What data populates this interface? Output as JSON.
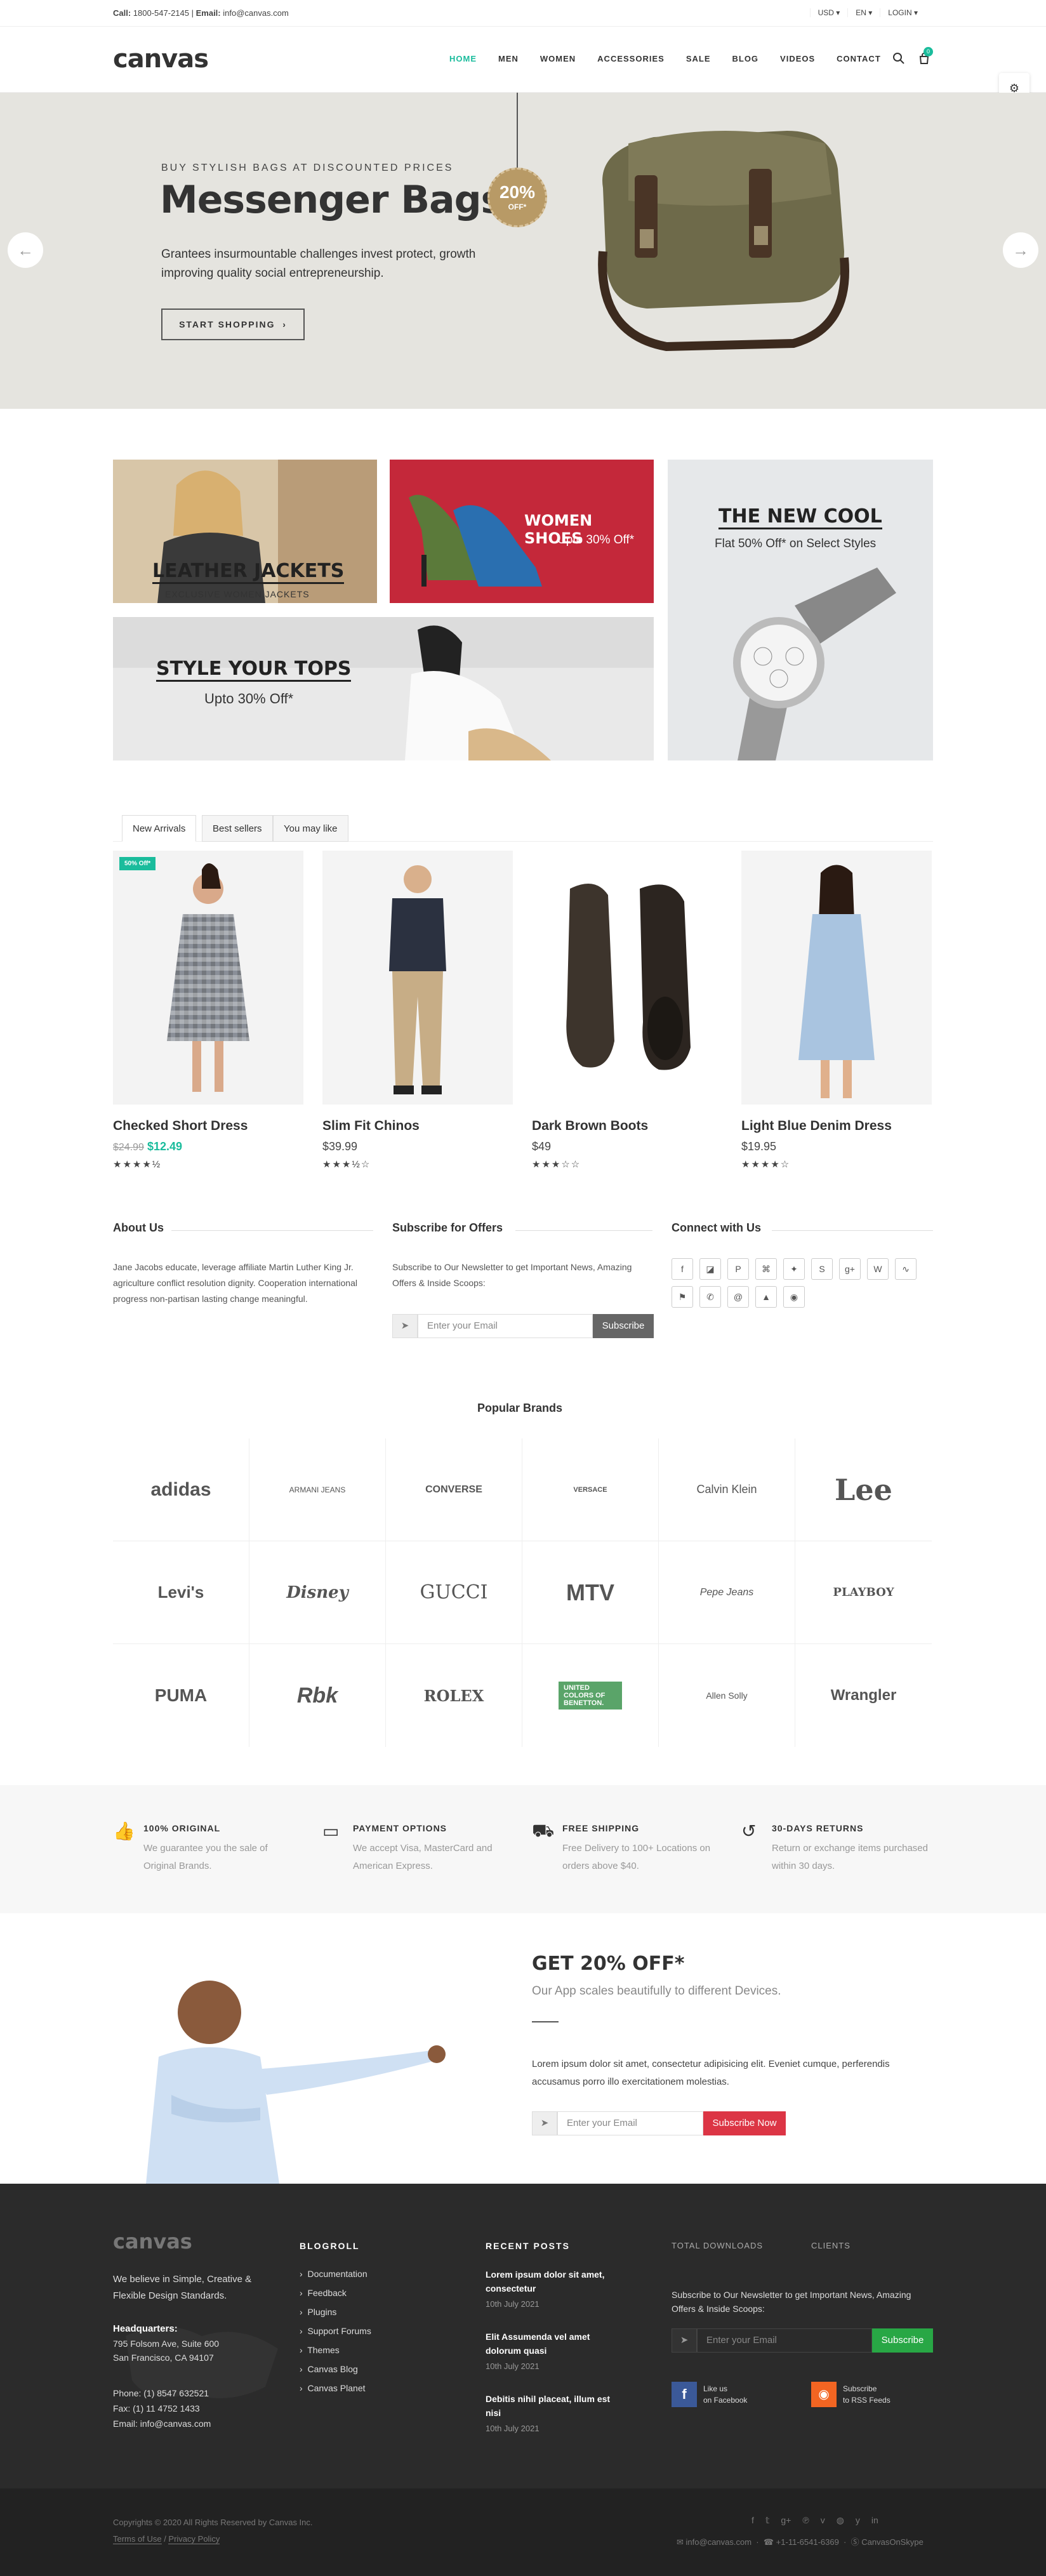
{
  "topbar": {
    "call_label": "Call:",
    "phone": "1800-547-2145",
    "email_label": "Email:",
    "email": "info@canvas.com",
    "currency": "USD",
    "language": "EN",
    "login": "LOGIN"
  },
  "header": {
    "logo": "canvas",
    "nav": [
      "HOME",
      "MEN",
      "WOMEN",
      "ACCESSORIES",
      "SALE",
      "BLOG",
      "VIDEOS",
      "CONTACT"
    ],
    "cart_count": "0"
  },
  "hero": {
    "pre": "BUY STYLISH BAGS AT DISCOUNTED PRICES",
    "title": "Messenger Bags",
    "text": "Grantees insurmountable challenges invest protect, growth improving quality social entrepreneurship.",
    "button": "START SHOPPING",
    "tag_pct": "20%",
    "tag_off": "OFF*"
  },
  "banners": {
    "leather": "LEATHER JACKETS",
    "leather_sub": "EXCLUSIVE WOMEN JACKETS",
    "shoes": "WOMEN SHOES",
    "shoes_sub": "Upto 30% Off*",
    "tops": "STYLE YOUR TOPS",
    "tops_sub": "Upto 30% Off*",
    "cool": "THE NEW COOL",
    "cool_sub": "Flat 50% Off* on Select Styles"
  },
  "tabs": [
    "New Arrivals",
    "Best sellers",
    "You may like"
  ],
  "products": [
    {
      "name": "Checked Short Dress",
      "old_price": "$24.99",
      "price": "$12.49",
      "stars": "★★★★½",
      "badge": "50% Off*"
    },
    {
      "name": "Slim Fit Chinos",
      "price": "$39.99",
      "stars": "★★★½☆"
    },
    {
      "name": "Dark Brown Boots",
      "price": "$49",
      "stars": "★★★☆☆"
    },
    {
      "name": "Light Blue Denim Dress",
      "price": "$19.95",
      "stars": "★★★★☆"
    }
  ],
  "widgets": {
    "about_title": "About Us",
    "about_text": "Jane Jacobs educate, leverage affiliate Martin Luther King Jr. agriculture conflict resolution dignity. Cooperation international progress non-partisan lasting change meaningful.",
    "subscribe_title": "Subscribe for Offers",
    "subscribe_text": "Subscribe to Our Newsletter to get Important News, Amazing Offers & Inside Scoops:",
    "subscribe_placeholder": "Enter your Email",
    "subscribe_button": "Subscribe",
    "connect_title": "Connect with Us"
  },
  "brands": {
    "title": "Popular Brands",
    "items": [
      "adidas",
      "ARMANI JEANS",
      "CONVERSE",
      "VERSACE",
      "Calvin Klein",
      "Lee",
      "Levi's",
      "Disney",
      "GUCCI",
      "MTV",
      "Pepe Jeans",
      "PLAYBOY",
      "PUMA",
      "Rbk",
      "ROLEX",
      "UNITED COLORS OF BENETTON.",
      "Allen Solly",
      "Wrangler"
    ]
  },
  "features": [
    {
      "title": "100% ORIGINAL",
      "text": "We guarantee you the sale of Original Brands."
    },
    {
      "title": "PAYMENT OPTIONS",
      "text": "We accept Visa, MasterCard and American Express."
    },
    {
      "title": "FREE SHIPPING",
      "text": "Free Delivery to 100+ Locations on orders above $40."
    },
    {
      "title": "30-DAYS RETURNS",
      "text": "Return or exchange items purchased within 30 days."
    }
  ],
  "promo": {
    "title": "GET 20% OFF*",
    "subtitle": "Our App scales beautifully to different Devices.",
    "text": "Lorem ipsum dolor sit amet, consectetur adipisicing elit. Eveniet cumque, perferendis accusamus porro illo exercitationem molestias.",
    "placeholder": "Enter your Email",
    "button": "Subscribe Now"
  },
  "footer": {
    "logo": "canvas",
    "believe": "We believe in Simple, Creative & Flexible Design Standards.",
    "hq_label": "Headquarters:",
    "address1": "795 Folsom Ave, Suite 600",
    "address2": "San Francisco, CA 94107",
    "phone": "Phone: (1) 8547 632521",
    "fax": "Fax: (1) 11 4752 1433",
    "email": "Email: info@canvas.com",
    "blogroll_title": "BLOGROLL",
    "blogroll": [
      "Documentation",
      "Feedback",
      "Plugins",
      "Support Forums",
      "Themes",
      "Canvas Blog",
      "Canvas Planet"
    ],
    "recent_title": "RECENT POSTS",
    "posts": [
      {
        "title": "Lorem ipsum dolor sit amet, consectetur",
        "date": "10th July 2021"
      },
      {
        "title": "Elit Assumenda vel amet dolorum quasi",
        "date": "10th July 2021"
      },
      {
        "title": "Debitis nihil placeat, illum est nisi",
        "date": "10th July 2021"
      }
    ],
    "downloads_label": "TOTAL DOWNLOADS",
    "clients_label": "CLIENTS",
    "subscribe_text": "Subscribe to Our Newsletter to get Important News, Amazing Offers & Inside Scoops:",
    "subscribe_placeholder": "Enter your Email",
    "subscribe_button": "Subscribe",
    "fb_line1": "Like us",
    "fb_line2": "on Facebook",
    "rss_line1": "Subscribe",
    "rss_line2": "to RSS Feeds"
  },
  "copyright": {
    "text": "Copyrights © 2020 All Rights Reserved by Canvas Inc.",
    "terms": "Terms of Use",
    "privacy": "Privacy Policy",
    "email": "info@canvas.com",
    "phone": "+1-11-6541-6369",
    "skype": "CanvasOnSkype"
  },
  "colors": {
    "accent": "#1abc9c",
    "footer_bg": "#2b2b2b",
    "promo_button": "#dc3545",
    "subscribe_green": "#28a745"
  }
}
